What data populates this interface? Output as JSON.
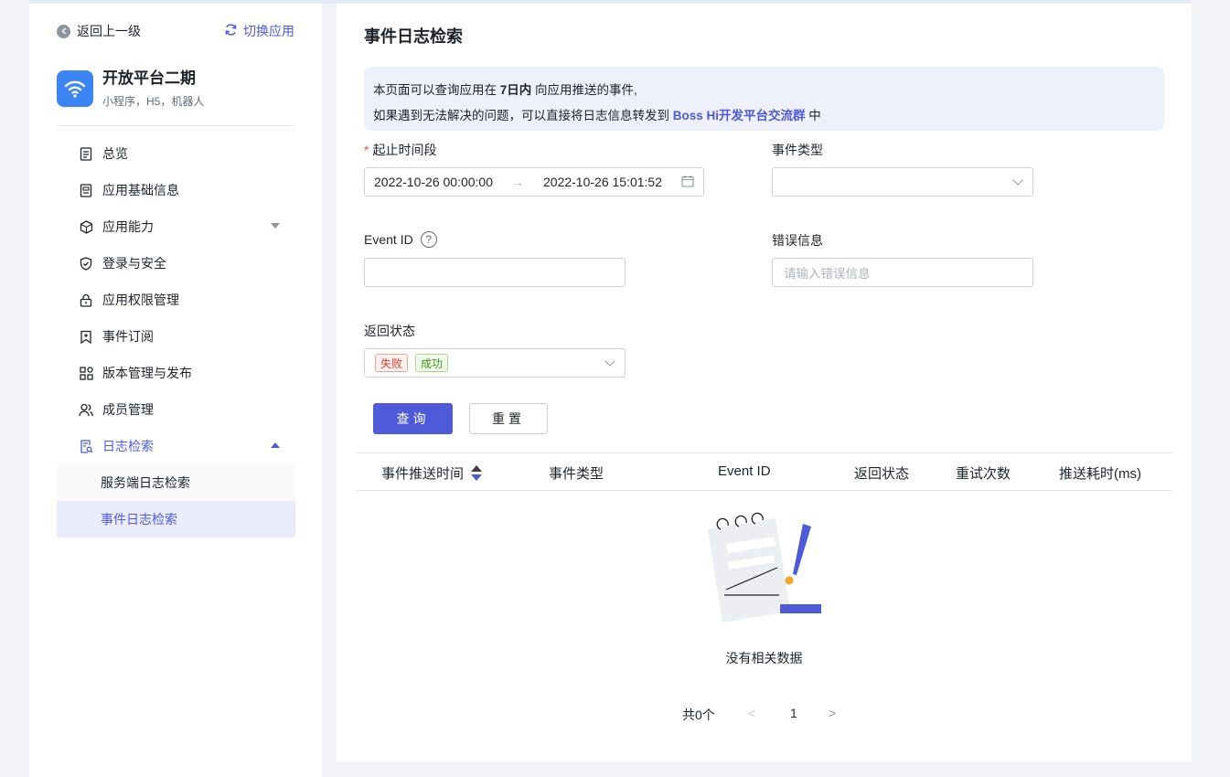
{
  "sidebar": {
    "back_label": "返回上一级",
    "switch_label": "切换应用",
    "app": {
      "name": "开放平台二期",
      "subtitle": "小程序，H5，机器人"
    },
    "menu": [
      {
        "label": "总览",
        "icon": "list-doc-icon"
      },
      {
        "label": "应用基础信息",
        "icon": "doc-icon"
      },
      {
        "label": "应用能力",
        "icon": "cube-icon"
      },
      {
        "label": "登录与安全",
        "icon": "shield-icon"
      },
      {
        "label": "应用权限管理",
        "icon": "lock-icon"
      },
      {
        "label": "事件订阅",
        "icon": "bookmark-icon"
      },
      {
        "label": "版本管理与发布",
        "icon": "grid-icon"
      },
      {
        "label": "成员管理",
        "icon": "users-icon"
      },
      {
        "label": "日志检索",
        "icon": "log-search-icon"
      }
    ],
    "submenu": [
      {
        "label": "服务端日志检索"
      },
      {
        "label": "事件日志检索"
      }
    ]
  },
  "main": {
    "title": "事件日志检索",
    "notice": {
      "line1_prefix": "本页面可以查询应用在",
      "line1_bold": "7日内",
      "line1_suffix": "向应用推送的事件,",
      "line2_prefix": "如果遇到无法解决的问题，可以直接将日志信息转发到",
      "line2_link": "Boss Hi开发平台交流群",
      "line2_suffix": "中"
    },
    "form": {
      "time_range": {
        "label": "起止时间段",
        "required_mark": "*",
        "start": "2022-10-26 00:00:00",
        "arrow": "→",
        "end": "2022-10-26 15:01:52"
      },
      "event_type": {
        "label": "事件类型",
        "value": ""
      },
      "event_id": {
        "label": "Event ID",
        "help": "?",
        "value": ""
      },
      "error_info": {
        "label": "错误信息",
        "placeholder": "请输入错误信息"
      },
      "return_status": {
        "label": "返回状态",
        "tags": [
          "失败",
          "成功"
        ]
      }
    },
    "buttons": {
      "query": "查询",
      "reset": "重置"
    },
    "table": {
      "columns": [
        "事件推送时间",
        "事件类型",
        "Event ID",
        "返回状态",
        "重试次数",
        "推送耗时(ms)"
      ],
      "empty_text": "没有相关数据"
    },
    "pagination": {
      "total": "共0个",
      "prev": "<",
      "page": "1",
      "next": ">"
    }
  },
  "colors": {
    "accent": "#4e5ad8",
    "notice_bg": "#eef0fc",
    "app_icon": "#3b86f4"
  }
}
